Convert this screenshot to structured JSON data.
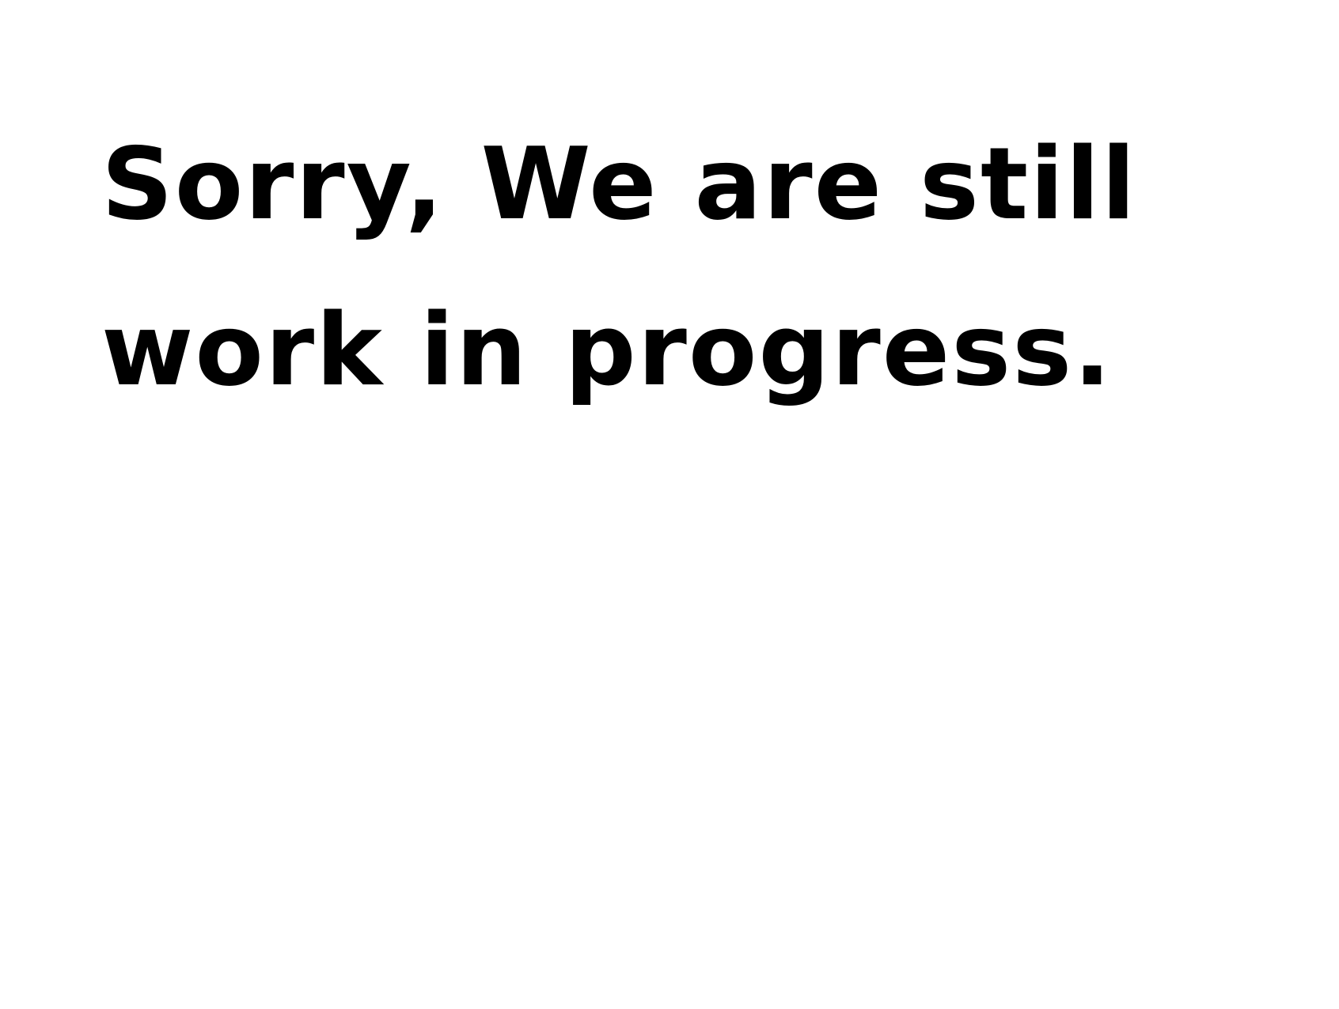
{
  "message": {
    "line1": "Sorry, We are still",
    "line2": "work in progress."
  },
  "colors": {
    "background": "#ffffff",
    "text": "#000000"
  }
}
